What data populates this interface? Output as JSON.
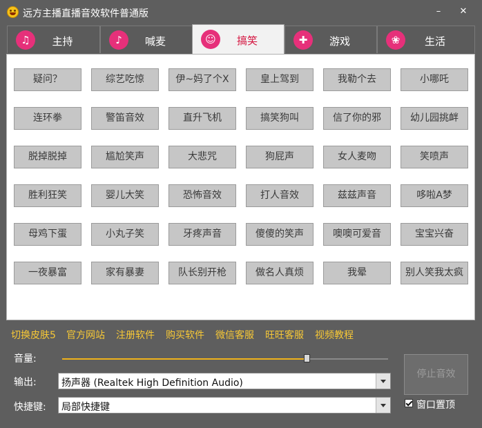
{
  "window": {
    "title": "远方主播直播音效软件普通版",
    "minimize": "–",
    "close": "✕"
  },
  "tabs": [
    {
      "label": "主持",
      "icon": "host-icon",
      "glyph": "♫",
      "active": false
    },
    {
      "label": "喊麦",
      "icon": "microphone-icon",
      "glyph": "♪",
      "active": false
    },
    {
      "label": "搞笑",
      "icon": "laugh-icon",
      "glyph": "☺",
      "active": true
    },
    {
      "label": "游戏",
      "icon": "gamepad-icon",
      "glyph": "✚",
      "active": false
    },
    {
      "label": "生活",
      "icon": "life-icon",
      "glyph": "❀",
      "active": false
    }
  ],
  "sound_buttons": [
    [
      "疑问？",
      "综艺吃惊",
      "伊~妈了个X",
      "皇上驾到",
      "我勒个去",
      "小哪吒"
    ],
    [
      "连环拳",
      "警笛音效",
      "直升飞机",
      "搞笑狗叫",
      "信了你的邪",
      "幼儿园挑衅"
    ],
    [
      "脱掉脱掉",
      "尴尬笑声",
      "大悲咒",
      "狗屁声",
      "女人麦吻",
      "笑喷声"
    ],
    [
      "胜利狂笑",
      "婴儿大笑",
      "恐怖音效",
      "打人音效",
      "兹兹声音",
      "哆啦A梦"
    ],
    [
      "母鸡下蛋",
      "小丸子笑",
      "牙疼声音",
      "傻傻的笑声",
      "噢噢可爱音",
      "宝宝兴奋"
    ],
    [
      "一夜暴富",
      "家有暴妻",
      "队长别开枪",
      "做名人真烦",
      "我晕",
      "别人笑我太疯"
    ]
  ],
  "links": [
    "切换皮肤5",
    "官方网站",
    "注册软件",
    "购买软件",
    "微信客服",
    "旺旺客服",
    "视频教程"
  ],
  "volume": {
    "label": "音量:",
    "level": 0.75
  },
  "output": {
    "label": "输出:",
    "value": "扬声器 (Realtek High Definition Audio)"
  },
  "hotkey": {
    "label": "快捷键:",
    "value": "局部快捷键"
  },
  "stop_button": "停止音效",
  "topmost": {
    "label": "窗口置顶",
    "checked": true
  },
  "colors": {
    "accent_pink": "#e6307a",
    "active_tab_text": "#d4103c",
    "link": "#f7c836",
    "slider": "#f0b21a"
  }
}
